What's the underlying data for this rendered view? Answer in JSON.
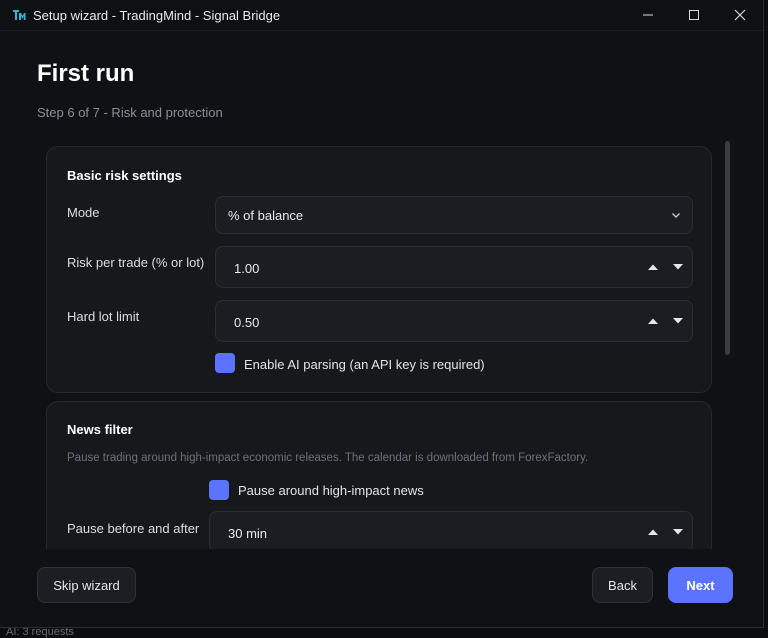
{
  "window": {
    "title": "Setup wizard - TradingMind - Signal Bridge",
    "accent_color": "#5b73ff"
  },
  "header": {
    "title": "First run",
    "step": "Step 6 of 7 - Risk and protection"
  },
  "basic_risk": {
    "title": "Basic risk settings",
    "mode_label": "Mode",
    "mode_value": "% of balance",
    "risk_label": "Risk per trade (% or lot)",
    "risk_value": "1.00",
    "lot_label": "Hard lot limit",
    "lot_value": "0.50",
    "ai_checkbox_label": "Enable AI parsing (an API key is required)",
    "ai_checked": true
  },
  "news_filter": {
    "title": "News filter",
    "description": "Pause trading around high-impact economic releases. The calendar is downloaded from ForexFactory.",
    "pause_checkbox_label": "Pause around high-impact news",
    "pause_checked": true,
    "pause_label": "Pause before and after",
    "pause_value": "30 min"
  },
  "footer": {
    "skip_label": "Skip wizard",
    "back_label": "Back",
    "next_label": "Next"
  },
  "background": {
    "status_text": "AI: 3 requests"
  }
}
